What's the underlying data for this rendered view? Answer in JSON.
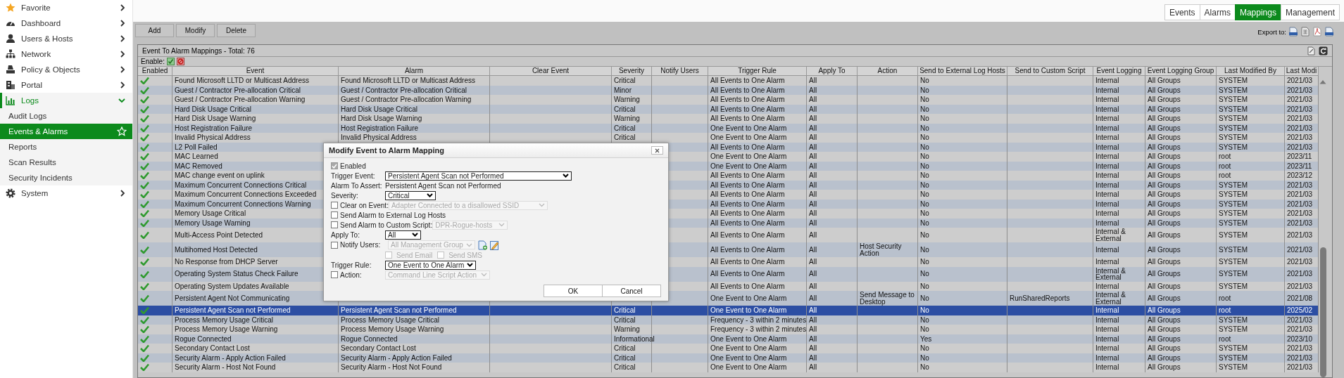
{
  "sidebar": {
    "items": [
      {
        "label": "Favorite",
        "expanded": false
      },
      {
        "label": "Dashboard",
        "expanded": false
      },
      {
        "label": "Users & Hosts",
        "expanded": false
      },
      {
        "label": "Network",
        "expanded": false
      },
      {
        "label": "Policy & Objects",
        "expanded": false
      },
      {
        "label": "Portal",
        "expanded": false
      },
      {
        "label": "Logs",
        "expanded": true,
        "children": [
          {
            "label": "Audit Logs",
            "selected": false
          },
          {
            "label": "Events & Alarms",
            "selected": true
          },
          {
            "label": "Reports",
            "selected": false
          },
          {
            "label": "Scan Results",
            "selected": false
          },
          {
            "label": "Security Incidents",
            "selected": false
          }
        ]
      },
      {
        "label": "System",
        "expanded": false
      }
    ]
  },
  "tabs": [
    {
      "label": "Events",
      "selected": false
    },
    {
      "label": "Alarms",
      "selected": false
    },
    {
      "label": "Mappings",
      "selected": true
    },
    {
      "label": "Management",
      "selected": false
    }
  ],
  "toolbar": {
    "buttons": [
      "Add",
      "Modify",
      "Delete"
    ],
    "export_label": "Export to:"
  },
  "panel": {
    "title": "Event To Alarm Mappings - Total: 76",
    "enable_label": "Enable:"
  },
  "table": {
    "columns": [
      "Enabled",
      "Event",
      "Alarm",
      "Clear Event",
      "Severity",
      "Notify Users",
      "Trigger Rule",
      "Apply To",
      "Action",
      "Send to External Log Hosts",
      "Send to Custom Script",
      "Event Logging",
      "Event Logging Group",
      "Last Modified By",
      "Last Modi"
    ],
    "rows": [
      {
        "enabled": true,
        "selected": false,
        "event": "Found Microsoft LLTD or Multicast Address",
        "alarm": "Found Microsoft LLTD or Multicast Address",
        "severity": "Critical",
        "trigger_rule": "All Events to One Alarm",
        "apply_to": "All",
        "external_log": "No",
        "logging": "Internal",
        "logging_group": "All Groups",
        "modified_by": "SYSTEM",
        "modified": "2021/03"
      },
      {
        "enabled": true,
        "selected": false,
        "event": "Guest / Contractor Pre-allocation Critical",
        "alarm": "Guest / Contractor Pre-allocation Critical",
        "severity": "Minor",
        "trigger_rule": "All Events to One Alarm",
        "apply_to": "All",
        "external_log": "No",
        "logging": "Internal",
        "logging_group": "All Groups",
        "modified_by": "SYSTEM",
        "modified": "2021/03"
      },
      {
        "enabled": true,
        "selected": false,
        "event": "Guest / Contractor Pre-allocation Warning",
        "alarm": "Guest / Contractor Pre-allocation Warning",
        "severity": "Warning",
        "trigger_rule": "All Events to One Alarm",
        "apply_to": "All",
        "external_log": "No",
        "logging": "Internal",
        "logging_group": "All Groups",
        "modified_by": "SYSTEM",
        "modified": "2021/03"
      },
      {
        "enabled": true,
        "selected": false,
        "event": "Hard Disk Usage Critical",
        "alarm": "Hard Disk Usage Critical",
        "severity": "Critical",
        "trigger_rule": "All Events to One Alarm",
        "apply_to": "All",
        "external_log": "No",
        "logging": "Internal",
        "logging_group": "All Groups",
        "modified_by": "SYSTEM",
        "modified": "2021/03"
      },
      {
        "enabled": true,
        "selected": false,
        "event": "Hard Disk Usage Warning",
        "alarm": "Hard Disk Usage Warning",
        "severity": "Warning",
        "trigger_rule": "All Events to One Alarm",
        "apply_to": "All",
        "external_log": "No",
        "logging": "Internal",
        "logging_group": "All Groups",
        "modified_by": "SYSTEM",
        "modified": "2021/03"
      },
      {
        "enabled": true,
        "selected": false,
        "event": "Host Registration Failure",
        "alarm": "Host Registration Failure",
        "severity": "Critical",
        "trigger_rule": "One Event to One Alarm",
        "apply_to": "All",
        "external_log": "No",
        "logging": "Internal",
        "logging_group": "All Groups",
        "modified_by": "SYSTEM",
        "modified": "2021/03"
      },
      {
        "enabled": true,
        "selected": false,
        "event": "Invalid Physical Address",
        "alarm": "Invalid Physical Address",
        "severity": "Critical",
        "trigger_rule": "One Event to One Alarm",
        "apply_to": "All",
        "external_log": "No",
        "logging": "Internal",
        "logging_group": "All Groups",
        "modified_by": "SYSTEM",
        "modified": "2021/03"
      },
      {
        "enabled": true,
        "selected": false,
        "event": "L2 Poll Failed",
        "trigger_rule": "All Events to One Alarm",
        "apply_to": "All",
        "external_log": "No",
        "logging": "Internal",
        "logging_group": "All Groups",
        "modified_by": "SYSTEM",
        "modified": "2021/03"
      },
      {
        "enabled": true,
        "selected": false,
        "event": "MAC Learned",
        "trigger_rule": "One Event to One Alarm",
        "apply_to": "All",
        "external_log": "No",
        "logging": "Internal",
        "logging_group": "All Groups",
        "modified_by": "root",
        "modified": "2023/11"
      },
      {
        "enabled": true,
        "selected": false,
        "event": "MAC Removed",
        "trigger_rule": "One Event to One Alarm",
        "apply_to": "All",
        "external_log": "No",
        "logging": "Internal",
        "logging_group": "All Groups",
        "modified_by": "root",
        "modified": "2023/11"
      },
      {
        "enabled": true,
        "selected": false,
        "event": "MAC change event on uplink",
        "trigger_rule": "All Events to One Alarm",
        "apply_to": "All",
        "external_log": "No",
        "logging": "Internal",
        "logging_group": "All Groups",
        "modified_by": "root",
        "modified": "2023/12"
      },
      {
        "enabled": true,
        "selected": false,
        "event": "Maximum Concurrent Connections Critical",
        "trigger_rule": "All Events to One Alarm",
        "apply_to": "All",
        "external_log": "No",
        "logging": "Internal",
        "logging_group": "All Groups",
        "modified_by": "SYSTEM",
        "modified": "2021/03"
      },
      {
        "enabled": true,
        "selected": false,
        "event": "Maximum Concurrent Connections Exceeded",
        "trigger_rule": "All Events to One Alarm",
        "apply_to": "All",
        "external_log": "No",
        "logging": "Internal",
        "logging_group": "All Groups",
        "modified_by": "SYSTEM",
        "modified": "2021/03"
      },
      {
        "enabled": true,
        "selected": false,
        "event": "Maximum Concurrent Connections Warning",
        "trigger_rule": "All Events to One Alarm",
        "apply_to": "All",
        "external_log": "No",
        "logging": "Internal",
        "logging_group": "All Groups",
        "modified_by": "SYSTEM",
        "modified": "2021/03"
      },
      {
        "enabled": true,
        "selected": false,
        "event": "Memory Usage Critical",
        "trigger_rule": "All Events to One Alarm",
        "apply_to": "All",
        "external_log": "No",
        "logging": "Internal",
        "logging_group": "All Groups",
        "modified_by": "SYSTEM",
        "modified": "2021/03"
      },
      {
        "enabled": true,
        "selected": false,
        "event": "Memory Usage Warning",
        "trigger_rule": "All Events to One Alarm",
        "apply_to": "All",
        "external_log": "No",
        "logging": "Internal",
        "logging_group": "All Groups",
        "modified_by": "SYSTEM",
        "modified": "2021/03"
      },
      {
        "enabled": true,
        "selected": false,
        "event": "Multi-Access Point Detected",
        "trigger_rule": "All Events to One Alarm",
        "apply_to": "All",
        "external_log": "No",
        "logging": "Internal & External",
        "logging_group": "All Groups",
        "modified_by": "SYSTEM",
        "modified": "2021/03"
      },
      {
        "enabled": true,
        "selected": false,
        "event": "Multihomed Host Detected",
        "trigger_rule": "All Events to One Alarm",
        "apply_to": "All",
        "action": "Host Security Action",
        "external_log": "No",
        "logging": "Internal",
        "logging_group": "All Groups",
        "modified_by": "SYSTEM",
        "modified": "2021/03"
      },
      {
        "enabled": true,
        "selected": false,
        "event": "No Response from DHCP Server",
        "trigger_rule": "All Events to One Alarm",
        "apply_to": "All",
        "external_log": "No",
        "logging": "Internal",
        "logging_group": "All Groups",
        "modified_by": "SYSTEM",
        "modified": "2021/03"
      },
      {
        "enabled": true,
        "selected": false,
        "event": "Operating System Status Check Failure",
        "trigger_rule": "All Events to One Alarm",
        "apply_to": "All",
        "external_log": "No",
        "logging": "Internal & External",
        "logging_group": "All Groups",
        "modified_by": "SYSTEM",
        "modified": "2021/03"
      },
      {
        "enabled": true,
        "selected": false,
        "event": "Operating System Updates Available",
        "trigger_rule": "All Events to One Alarm",
        "apply_to": "All",
        "external_log": "No",
        "logging": "Internal",
        "logging_group": "All Groups",
        "modified_by": "SYSTEM",
        "modified": "2021/03"
      },
      {
        "enabled": true,
        "selected": false,
        "event": "Persistent Agent Not Communicating",
        "trigger_rule": "One Event to One Alarm",
        "apply_to": "All",
        "action": "Send Message to Desktop",
        "external_log": "No",
        "custom_script": "RunSharedReports",
        "logging": "Internal & External",
        "logging_group": "All Groups",
        "modified_by": "root",
        "modified": "2021/08"
      },
      {
        "enabled": true,
        "selected": true,
        "event": "Persistent Agent Scan not Performed",
        "alarm": "Persistent Agent Scan not Performed",
        "severity": "Critical",
        "trigger_rule": "One Event to One Alarm",
        "apply_to": "All",
        "external_log": "No",
        "logging": "Internal",
        "logging_group": "All Groups",
        "modified_by": "root",
        "modified": "2025/02"
      },
      {
        "enabled": true,
        "selected": false,
        "event": "Process Memory Usage Critical",
        "alarm": "Process Memory Usage Critical",
        "severity": "Critical",
        "trigger_rule": "Frequency - 3 within 2 minutes",
        "apply_to": "All",
        "external_log": "No",
        "logging": "Internal",
        "logging_group": "All Groups",
        "modified_by": "SYSTEM",
        "modified": "2021/03"
      },
      {
        "enabled": true,
        "selected": false,
        "event": "Process Memory Usage Warning",
        "alarm": "Process Memory Usage Warning",
        "severity": "Warning",
        "trigger_rule": "Frequency - 3 within 2 minutes",
        "apply_to": "All",
        "external_log": "No",
        "logging": "Internal",
        "logging_group": "All Groups",
        "modified_by": "SYSTEM",
        "modified": "2021/03"
      },
      {
        "enabled": true,
        "selected": false,
        "event": "Rogue Connected",
        "alarm": "Rogue Connected",
        "severity": "Informational",
        "trigger_rule": "One Event to One Alarm",
        "apply_to": "All",
        "external_log": "Yes",
        "logging": "Internal",
        "logging_group": "All Groups",
        "modified_by": "root",
        "modified": "2023/10"
      },
      {
        "enabled": true,
        "selected": false,
        "event": "Secondary Contact Lost",
        "alarm": "Secondary Contact Lost",
        "severity": "Critical",
        "trigger_rule": "One Event to One Alarm",
        "apply_to": "All",
        "external_log": "No",
        "logging": "Internal",
        "logging_group": "All Groups",
        "modified_by": "SYSTEM",
        "modified": "2021/03"
      },
      {
        "enabled": true,
        "selected": false,
        "event": "Security Alarm - Apply Action Failed",
        "alarm": "Security Alarm - Apply Action Failed",
        "severity": "Critical",
        "trigger_rule": "One Event to One Alarm",
        "apply_to": "All",
        "external_log": "No",
        "logging": "Internal",
        "logging_group": "All Groups",
        "modified_by": "SYSTEM",
        "modified": "2021/03"
      },
      {
        "enabled": true,
        "selected": false,
        "event": "Security Alarm - Host Not Found",
        "alarm": "Security Alarm - Host Not Found",
        "severity": "Critical",
        "trigger_rule": "One Event to One Alarm",
        "apply_to": "All",
        "external_log": "No",
        "logging": "Internal",
        "logging_group": "All Groups",
        "modified_by": "SYSTEM",
        "modified": "2021/03"
      }
    ]
  },
  "dialog": {
    "title": "Modify Event to Alarm Mapping",
    "fields": [
      {
        "kind": "checkbox",
        "label": "Enabled",
        "checked": true,
        "disabled": true
      },
      {
        "kind": "select",
        "label": "Trigger Event:",
        "value": "Persistent Agent Scan not Performed"
      },
      {
        "kind": "text",
        "label": "Alarm To Assert:",
        "value": "Persistent Agent Scan not Performed"
      },
      {
        "kind": "select",
        "label": "Severity:",
        "value": "Critical"
      },
      {
        "kind": "check_select",
        "label": "Clear on Event:",
        "checked": false,
        "value": "Adapter Connected to a disallowed SSID",
        "disabled": true
      },
      {
        "kind": "checkbox",
        "label": "Send Alarm to External Log Hosts",
        "checked": false,
        "disabled": false
      },
      {
        "kind": "check_select",
        "label": "Send Alarm to Custom Script:",
        "checked": false,
        "value": "DPR-Rogue-hosts",
        "disabled": true
      },
      {
        "kind": "select",
        "label": "Apply To:",
        "value": "All"
      },
      {
        "kind": "user_select",
        "label": "Notify Users:",
        "checked": false,
        "value": "All Management Group",
        "disabled": true
      },
      {
        "kind": "sub_checks",
        "items": [
          {
            "label": "Send Email",
            "checked": false,
            "disabled": true
          },
          {
            "label": "Send SMS",
            "checked": false,
            "disabled": true
          }
        ]
      },
      {
        "kind": "select",
        "label": "Trigger Rule:",
        "value": "One Event to One Alarm"
      },
      {
        "kind": "check_select",
        "label": "Action:",
        "checked": false,
        "value": "Command Line Script Action",
        "disabled": true
      }
    ],
    "buttons": [
      "OK",
      "Cancel"
    ]
  }
}
